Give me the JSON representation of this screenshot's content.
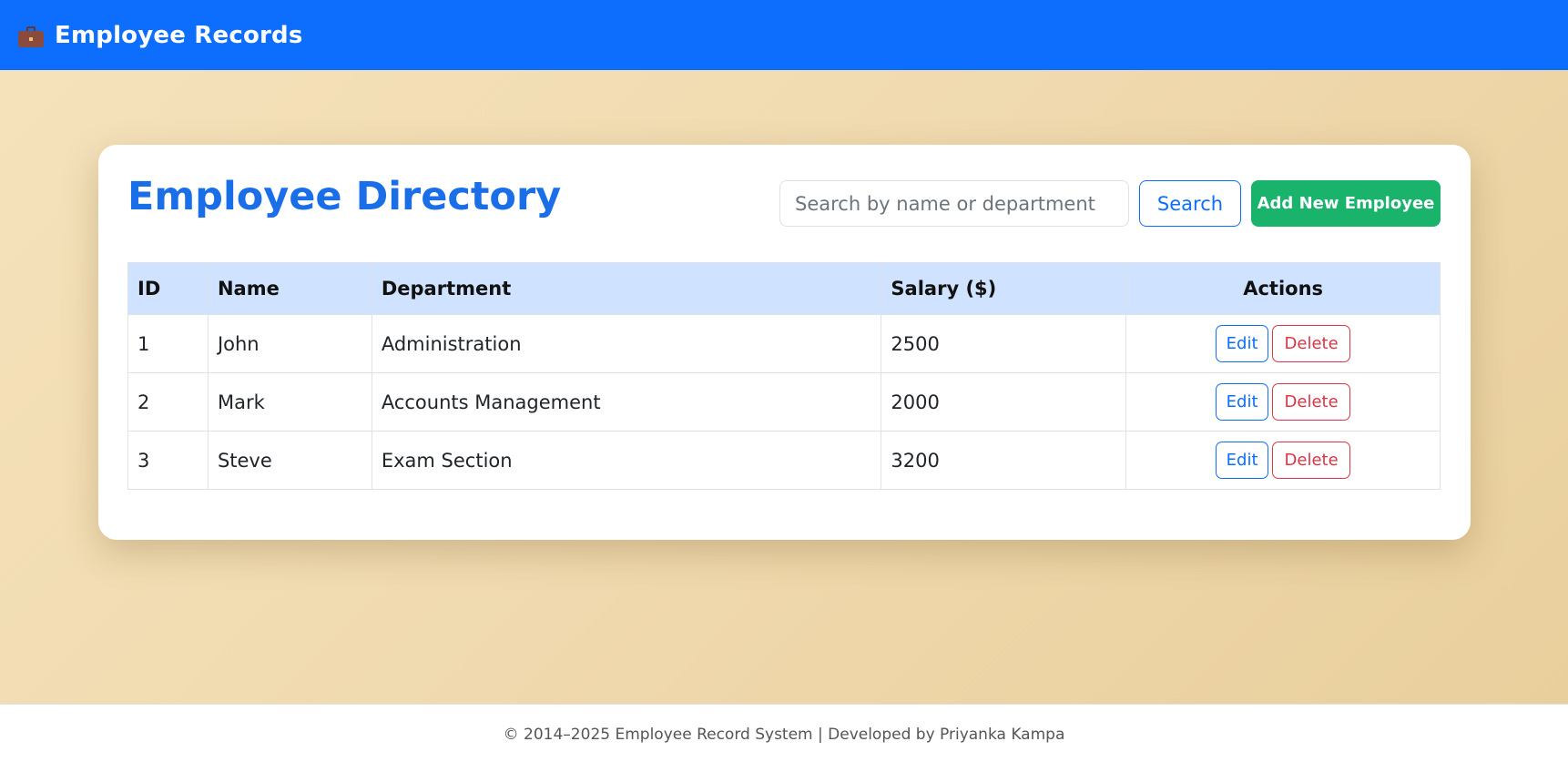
{
  "navbar": {
    "brand_icon": "briefcase-icon",
    "brand_text": "Employee Records",
    "background": "#0d6efd"
  },
  "page": {
    "title": "Employee Directory",
    "title_color": "#1a6fe8",
    "background_gradient": [
      "#f5e2bb",
      "#e9cf9c"
    ]
  },
  "search": {
    "placeholder": "Search by name or department",
    "value": "",
    "button_label": "Search"
  },
  "add_button_label": "Add New Employee",
  "add_button_color": "#19b36b",
  "table": {
    "headers": {
      "id": "ID",
      "name": "Name",
      "department": "Department",
      "salary": "Salary ($)",
      "actions": "Actions"
    },
    "header_background": "#cfe2ff",
    "rows": [
      {
        "id": "1",
        "name": "John",
        "department": "Administration",
        "salary": "2500",
        "edit_label": "Edit",
        "delete_label": "Delete"
      },
      {
        "id": "2",
        "name": "Mark",
        "department": "Accounts Management",
        "salary": "2000",
        "edit_label": "Edit",
        "delete_label": "Delete"
      },
      {
        "id": "3",
        "name": "Steve",
        "department": "Exam Section",
        "salary": "3200",
        "edit_label": "Edit",
        "delete_label": "Delete"
      }
    ]
  },
  "footer": {
    "text": "© 2014–2025 Employee Record System | Developed by Priyanka Kampa"
  }
}
